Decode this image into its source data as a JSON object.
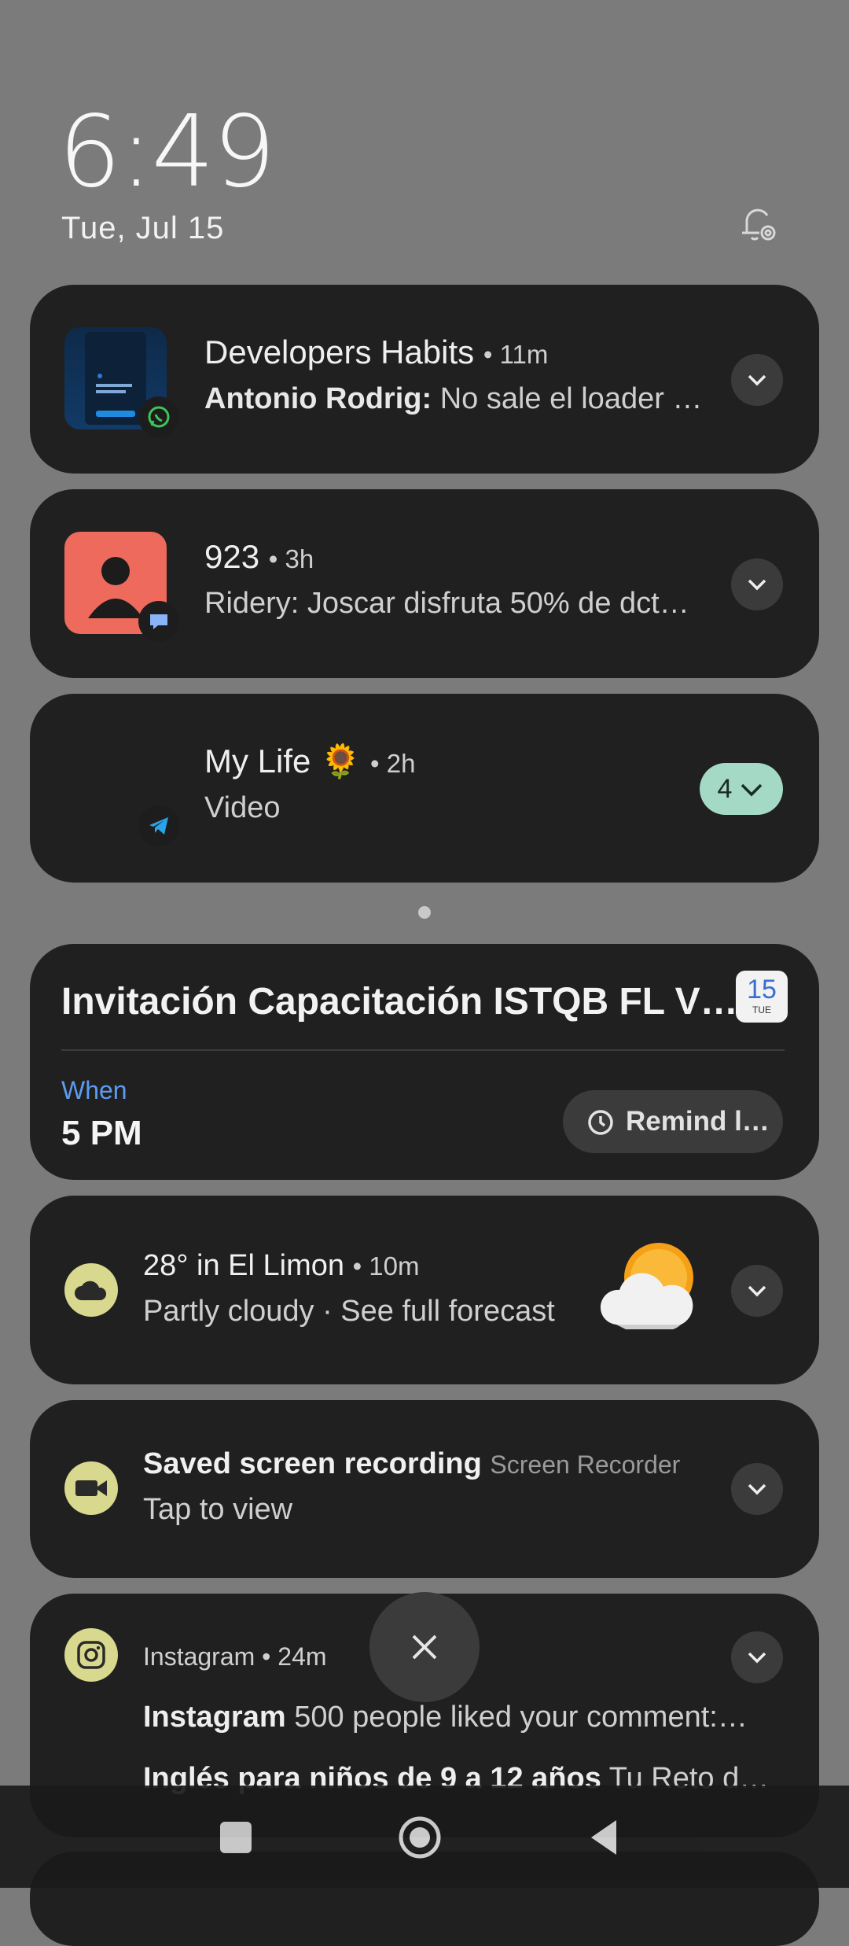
{
  "status": {
    "time": "6:49",
    "date": "Tue, Jul 15"
  },
  "notifications": [
    {
      "title": "Developers Habits",
      "time": "• 11m",
      "sender": "Antonio Rodrig:",
      "message": "No sale el loader  …",
      "app": "WhatsApp",
      "icon": "whatsapp-icon"
    },
    {
      "title": "923",
      "time": "• 3h",
      "message": "Ridery: Joscar disfruta 50% de dct…",
      "app": "Messages",
      "icon": "message-icon"
    },
    {
      "title": "My Life 🌻",
      "time": "• 2h",
      "message": "Video",
      "app": "Telegram",
      "icon": "telegram-icon",
      "count": "4"
    }
  ],
  "calendar": {
    "title": "Invitación Capacitación ISTQB FL V…",
    "day": "15",
    "weekday": "TUE",
    "when_label": "When",
    "when_value": "5 PM",
    "remind_label": "Remind l…"
  },
  "weather": {
    "title": "28° in El Limon",
    "time": "• 10m",
    "subtitle": "Partly cloudy · See full forecast"
  },
  "recorder": {
    "title": "Saved screen recording",
    "app": "Screen Recorder",
    "subtitle": "Tap to view"
  },
  "instagram": {
    "app": "Instagram",
    "time": "• 24m",
    "line1_bold": "Instagram",
    "line1": "500 people liked your comment:…",
    "line2_bold": "Inglés para niños de 9 a 12 años",
    "line2": "Tu Reto d…"
  },
  "colors": {
    "accent_blue": "#5c9cf2",
    "icon_yellow": "#d8d98e",
    "count_pill": "#a3d9c5",
    "card_bg": "#202020"
  }
}
